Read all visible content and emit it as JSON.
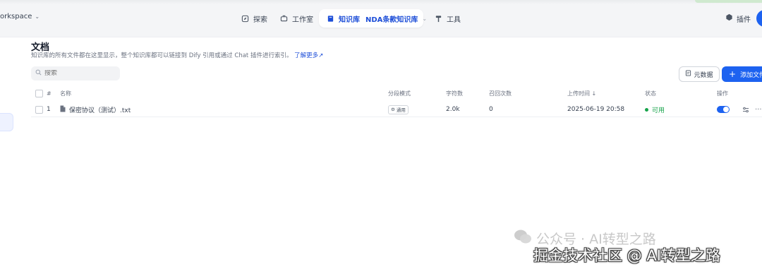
{
  "header": {
    "workspace_label": "orkspace",
    "nav": {
      "explore": "探索",
      "studio": "工作室",
      "knowledge": "知识库",
      "dataset_name": "NDA条款知识库",
      "tools": "工具"
    },
    "plugins": "插件"
  },
  "page": {
    "title": "文档",
    "description": "知识库的所有文件都在这里显示，整个知识库都可以链接到 Dify 引用或通过 Chat 插件进行索引。",
    "learn_more": "了解更多"
  },
  "toolbar": {
    "search_placeholder": "搜索",
    "metadata_button": "元数据",
    "add_file_button": "添加文件"
  },
  "table": {
    "columns": {
      "index": "#",
      "name": "名称",
      "mode": "分段模式",
      "chars": "字符数",
      "hits": "召回次数",
      "uploaded": "上传时间 ↓",
      "status": "状态",
      "actions": "操作"
    },
    "rows": [
      {
        "index": "1",
        "name": "保密协议（测试）.txt",
        "mode": "通用",
        "chars": "2.0k",
        "hits": "0",
        "uploaded": "2025-06-19 20:58",
        "status": "可用",
        "enabled": true
      }
    ]
  },
  "watermark": {
    "line1": "公众号 · AI转型之路",
    "line2": "掘金技术社区 @ AI转型之路"
  },
  "colors": {
    "accent": "#1d62f0",
    "status_ok": "#16a34a"
  }
}
